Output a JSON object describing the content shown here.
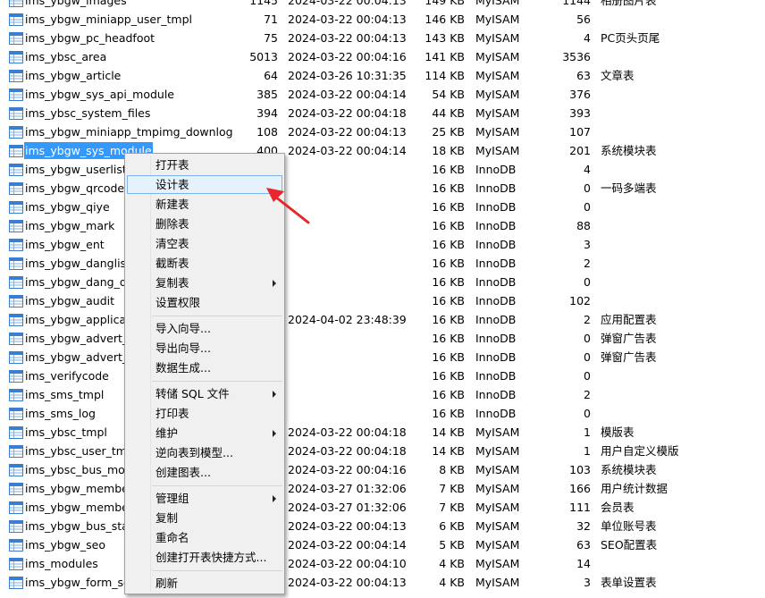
{
  "tables": [
    {
      "name": "ims_ybgw_images",
      "rows": "1145",
      "date": "2024-03-22 00:04:13",
      "size": "149 KB",
      "engine": "MyISAM",
      "auto": "1144",
      "comment": "相册图片表"
    },
    {
      "name": "ims_ybgw_miniapp_user_tmpl",
      "rows": "71",
      "date": "2024-03-22 00:04:13",
      "size": "146 KB",
      "engine": "MyISAM",
      "auto": "56",
      "comment": ""
    },
    {
      "name": "ims_ybgw_pc_headfoot",
      "rows": "75",
      "date": "2024-03-22 00:04:13",
      "size": "143 KB",
      "engine": "MyISAM",
      "auto": "4",
      "comment": "PC页头页尾"
    },
    {
      "name": "ims_ybsc_area",
      "rows": "5013",
      "date": "2024-03-22 00:04:16",
      "size": "141 KB",
      "engine": "MyISAM",
      "auto": "3536",
      "comment": ""
    },
    {
      "name": "ims_ybgw_article",
      "rows": "64",
      "date": "2024-03-26 10:31:35",
      "size": "114 KB",
      "engine": "MyISAM",
      "auto": "63",
      "comment": "文章表"
    },
    {
      "name": "ims_ybgw_sys_api_module",
      "rows": "385",
      "date": "2024-03-22 00:04:14",
      "size": "54 KB",
      "engine": "MyISAM",
      "auto": "376",
      "comment": ""
    },
    {
      "name": "ims_ybsc_system_files",
      "rows": "394",
      "date": "2024-03-22 00:04:18",
      "size": "44 KB",
      "engine": "MyISAM",
      "auto": "393",
      "comment": ""
    },
    {
      "name": "ims_ybgw_miniapp_tmpimg_downlog",
      "rows": "108",
      "date": "2024-03-22 00:04:13",
      "size": "25 KB",
      "engine": "MyISAM",
      "auto": "107",
      "comment": ""
    },
    {
      "name": "ims_ybgw_sys_module",
      "rows": "400",
      "date": "2024-03-22 00:04:14",
      "size": "18 KB",
      "engine": "MyISAM",
      "auto": "201",
      "comment": "系统模块表",
      "selected": true
    },
    {
      "name": "ims_ybgw_userlist_v",
      "rows": "",
      "date": "",
      "size": "16 KB",
      "engine": "InnoDB",
      "auto": "4",
      "comment": ""
    },
    {
      "name": "ims_ybgw_qrcode",
      "rows": "",
      "date": "",
      "size": "16 KB",
      "engine": "InnoDB",
      "auto": "0",
      "comment": "一码多端表"
    },
    {
      "name": "ims_ybgw_qiye",
      "rows": "",
      "date": "",
      "size": "16 KB",
      "engine": "InnoDB",
      "auto": "0",
      "comment": ""
    },
    {
      "name": "ims_ybgw_mark",
      "rows": "",
      "date": "",
      "size": "16 KB",
      "engine": "InnoDB",
      "auto": "88",
      "comment": ""
    },
    {
      "name": "ims_ybgw_ent",
      "rows": "",
      "date": "",
      "size": "16 KB",
      "engine": "InnoDB",
      "auto": "3",
      "comment": ""
    },
    {
      "name": "ims_ybgw_danglist",
      "rows": "",
      "date": "",
      "size": "16 KB",
      "engine": "InnoDB",
      "auto": "2",
      "comment": ""
    },
    {
      "name": "ims_ybgw_dang_qir",
      "rows": "",
      "date": "",
      "size": "16 KB",
      "engine": "InnoDB",
      "auto": "0",
      "comment": ""
    },
    {
      "name": "ims_ybgw_audit",
      "rows": "",
      "date": "",
      "size": "16 KB",
      "engine": "InnoDB",
      "auto": "102",
      "comment": ""
    },
    {
      "name": "ims_ybgw_applicati",
      "rows": "",
      "date": "2024-04-02 23:48:39",
      "size": "16 KB",
      "engine": "InnoDB",
      "auto": "2",
      "comment": "应用配置表"
    },
    {
      "name": "ims_ybgw_advert_p",
      "rows": "",
      "date": "",
      "size": "16 KB",
      "engine": "InnoDB",
      "auto": "0",
      "comment": "弹窗广告表"
    },
    {
      "name": "ims_ybgw_advert_p",
      "rows": "",
      "date": "",
      "size": "16 KB",
      "engine": "InnoDB",
      "auto": "0",
      "comment": "弹窗广告表"
    },
    {
      "name": "ims_verifycode",
      "rows": "",
      "date": "",
      "size": "16 KB",
      "engine": "InnoDB",
      "auto": "0",
      "comment": ""
    },
    {
      "name": "ims_sms_tmpl",
      "rows": "",
      "date": "",
      "size": "16 KB",
      "engine": "InnoDB",
      "auto": "2",
      "comment": ""
    },
    {
      "name": "ims_sms_log",
      "rows": "",
      "date": "",
      "size": "16 KB",
      "engine": "InnoDB",
      "auto": "0",
      "comment": ""
    },
    {
      "name": "ims_ybsc_tmpl",
      "rows": "",
      "date": "2024-03-22 00:04:18",
      "size": "14 KB",
      "engine": "MyISAM",
      "auto": "1",
      "comment": "模版表"
    },
    {
      "name": "ims_ybsc_user_tmpl",
      "rows": "",
      "date": "2024-03-22 00:04:18",
      "size": "14 KB",
      "engine": "MyISAM",
      "auto": "1",
      "comment": "用户自定义模版"
    },
    {
      "name": "ims_ybsc_bus_modu",
      "rows": "",
      "date": "2024-03-22 00:04:16",
      "size": "8 KB",
      "engine": "MyISAM",
      "auto": "103",
      "comment": "系统模块表"
    },
    {
      "name": "ims_ybgw_member_",
      "rows": "",
      "date": "2024-03-27 01:32:06",
      "size": "7 KB",
      "engine": "MyISAM",
      "auto": "166",
      "comment": "用户统计数据"
    },
    {
      "name": "ims_ybgw_member",
      "rows": "",
      "date": "2024-03-27 01:32:06",
      "size": "7 KB",
      "engine": "MyISAM",
      "auto": "111",
      "comment": "会员表"
    },
    {
      "name": "ims_ybgw_bus_staff",
      "rows": "",
      "date": "2024-03-22 00:04:13",
      "size": "6 KB",
      "engine": "MyISAM",
      "auto": "32",
      "comment": "单位账号表"
    },
    {
      "name": "ims_ybgw_seo",
      "rows": "",
      "date": "2024-03-22 00:04:14",
      "size": "5 KB",
      "engine": "MyISAM",
      "auto": "63",
      "comment": "SEO配置表"
    },
    {
      "name": "ims_modules",
      "rows": "",
      "date": "2024-03-22 00:04:10",
      "size": "4 KB",
      "engine": "MyISAM",
      "auto": "14",
      "comment": ""
    },
    {
      "name": "ims_ybgw_form_set",
      "rows": "",
      "date": "2024-03-22 00:04:13",
      "size": "4 KB",
      "engine": "MyISAM",
      "auto": "3",
      "comment": "表单设置表"
    }
  ],
  "context_menu": {
    "items": [
      {
        "label": "打开表",
        "name": "menu-open-table"
      },
      {
        "label": "设计表",
        "name": "menu-design-table",
        "highlighted": true
      },
      {
        "label": "新建表",
        "name": "menu-new-table"
      },
      {
        "label": "删除表",
        "name": "menu-delete-table"
      },
      {
        "label": "清空表",
        "name": "menu-empty-table"
      },
      {
        "label": "截断表",
        "name": "menu-truncate-table"
      },
      {
        "label": "复制表",
        "name": "menu-duplicate-table",
        "submenu": true
      },
      {
        "label": "设置权限",
        "name": "menu-set-permissions"
      },
      {
        "separator": true
      },
      {
        "label": "导入向导...",
        "name": "menu-import-wizard"
      },
      {
        "label": "导出向导...",
        "name": "menu-export-wizard"
      },
      {
        "label": "数据生成...",
        "name": "menu-data-generation"
      },
      {
        "separator": true
      },
      {
        "label": "转储 SQL 文件",
        "name": "menu-dump-sql",
        "submenu": true
      },
      {
        "label": "打印表",
        "name": "menu-print-table"
      },
      {
        "label": "维护",
        "name": "menu-maintain",
        "submenu": true
      },
      {
        "label": "逆向表到模型...",
        "name": "menu-reverse-to-model"
      },
      {
        "label": "创建图表...",
        "name": "menu-create-chart"
      },
      {
        "separator": true
      },
      {
        "label": "管理组",
        "name": "menu-manage-group",
        "submenu": true
      },
      {
        "label": "复制",
        "name": "menu-copy"
      },
      {
        "label": "重命名",
        "name": "menu-rename"
      },
      {
        "label": "创建打开表快捷方式...",
        "name": "menu-create-shortcut"
      },
      {
        "separator": true
      },
      {
        "label": "刷新",
        "name": "menu-refresh"
      }
    ]
  },
  "colors": {
    "selection": "#3399ff",
    "menu_highlight": "#e5f1fb",
    "annotation_arrow": "#e8262b"
  }
}
